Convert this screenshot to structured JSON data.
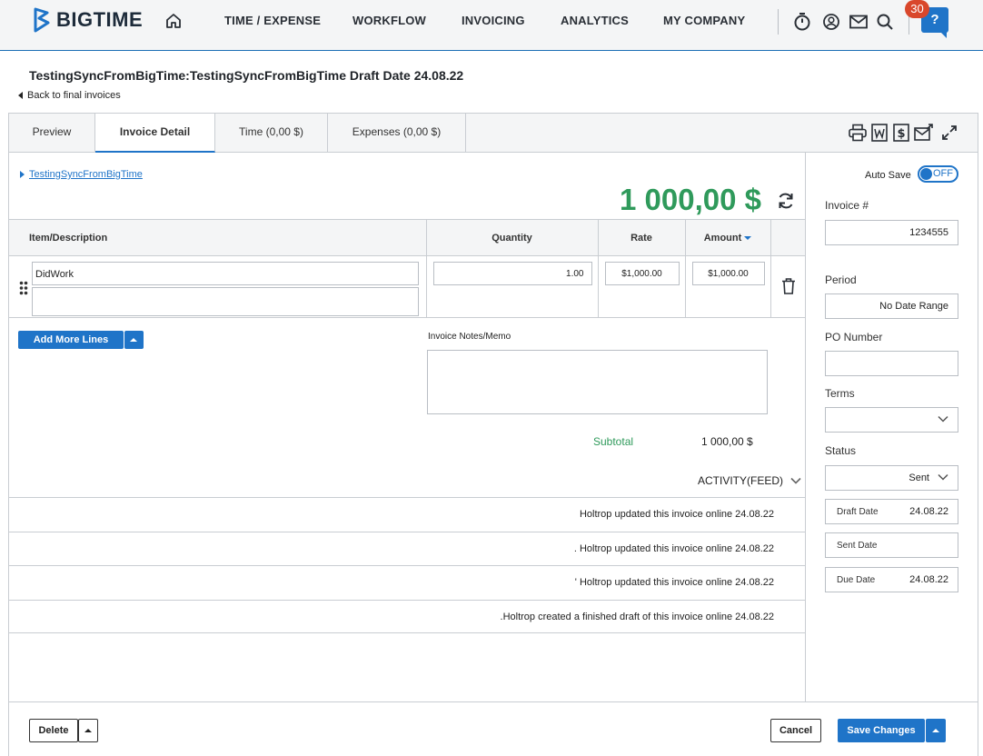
{
  "nav": {
    "brand": "BIGTIME",
    "links": [
      "TIME / EXPENSE",
      "WORKFLOW",
      "INVOICING",
      "ANALYTICS",
      "MY COMPANY"
    ],
    "notification_count": "30",
    "help_label": "?"
  },
  "page": {
    "title": "TestingSyncFromBigTime:TestingSyncFromBigTime Draft Date 24.08.22",
    "back_link": "Back to final invoices"
  },
  "tabs": [
    "Preview",
    "Invoice Detail",
    "Time (0,00 $)",
    "Expenses (0,00 $)"
  ],
  "invoice": {
    "client_link": "TestingSyncFromBigTime",
    "total": "1 000,00 $",
    "columns": {
      "item": "Item/Description",
      "quantity": "Quantity",
      "rate": "Rate",
      "amount": "Amount"
    },
    "line": {
      "description": "DidWork",
      "quantity": "1.00",
      "rate": "$1,000.00",
      "amount": "$1,000.00"
    },
    "add_lines_label": "Add More Lines",
    "memo_label": "Invoice Notes/Memo",
    "subtotal_label": "Subtotal",
    "subtotal_value": "1 000,00 $",
    "activity_label": "ACTIVITY(FEED)"
  },
  "feed": [
    "Holtrop updated this invoice online 24.08.22",
    ". Holtrop updated this invoice online 24.08.22",
    "' Holtrop updated this invoice online 24.08.22",
    ".Holtrop created a finished draft of this invoice online 24.08.22"
  ],
  "sidebar": {
    "autosave_label": "Auto Save",
    "autosave_state": "OFF",
    "invoice_no_label": "Invoice #",
    "invoice_no_value": "1234555",
    "period_label": "Period",
    "period_value": "No Date Range",
    "po_label": "PO Number",
    "po_value": "",
    "terms_label": "Terms",
    "terms_value": "",
    "status_label": "Status",
    "status_value": "Sent",
    "draft_date_label": "Draft Date",
    "draft_date_value": "24.08.22",
    "sent_date_label": "Sent Date",
    "sent_date_value": "",
    "due_date_label": "Due Date",
    "due_date_value": "24.08.22"
  },
  "footer": {
    "delete_label": "Delete",
    "cancel_label": "Cancel",
    "save_label": "Save Changes"
  },
  "colors": {
    "accent": "#1f74c8",
    "total_green": "#2f9a5b",
    "badge_red": "#d9472b"
  }
}
